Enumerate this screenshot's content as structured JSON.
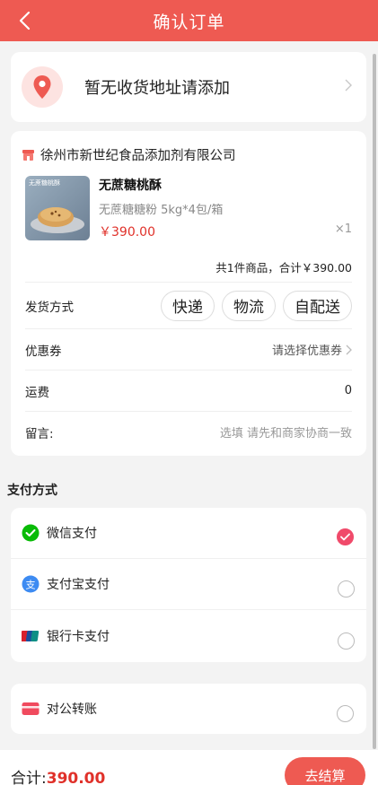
{
  "header": {
    "title": "确认订单"
  },
  "address": {
    "placeholder_text": "暂无收货地址请添加"
  },
  "order": {
    "shop_name": "徐州市新世纪食品添加剂有限公司",
    "product": {
      "thumb_tag": "无蔗糖桃酥",
      "name": "无蔗糖桃酥",
      "spec": "无蔗糖糖粉 5kg*4包/箱",
      "price": "￥390.00",
      "qty": "×1"
    },
    "total_line": "共1件商品，合计￥390.00",
    "delivery": {
      "label": "发货方式",
      "options": [
        "快递",
        "物流",
        "自配送"
      ]
    },
    "coupon": {
      "label": "优惠券",
      "value": "请选择优惠券"
    },
    "shipping": {
      "label": "运费",
      "value": "0"
    },
    "remark": {
      "label": "留言:",
      "placeholder": "选填 请先和商家协商一致"
    }
  },
  "payment": {
    "title": "支付方式",
    "methods": [
      {
        "label": "微信支付",
        "selected": true,
        "icon": "wechat-pay-icon",
        "color": "#09bb07"
      },
      {
        "label": "支付宝支付",
        "selected": false,
        "icon": "alipay-icon",
        "color": "#3d8bf2"
      },
      {
        "label": "银行卡支付",
        "selected": false,
        "icon": "unionpay-icon",
        "color": "#d8202c"
      }
    ],
    "corporate": {
      "label": "对公转账",
      "selected": false,
      "icon": "card-icon",
      "color": "#f04a5e"
    }
  },
  "footer": {
    "total_label": "合计:",
    "total_amount": "390.00",
    "checkout_label": "去结算"
  },
  "colors": {
    "brand": "#ee5a52",
    "price": "#e0312a",
    "selected": "#f04a6a"
  }
}
